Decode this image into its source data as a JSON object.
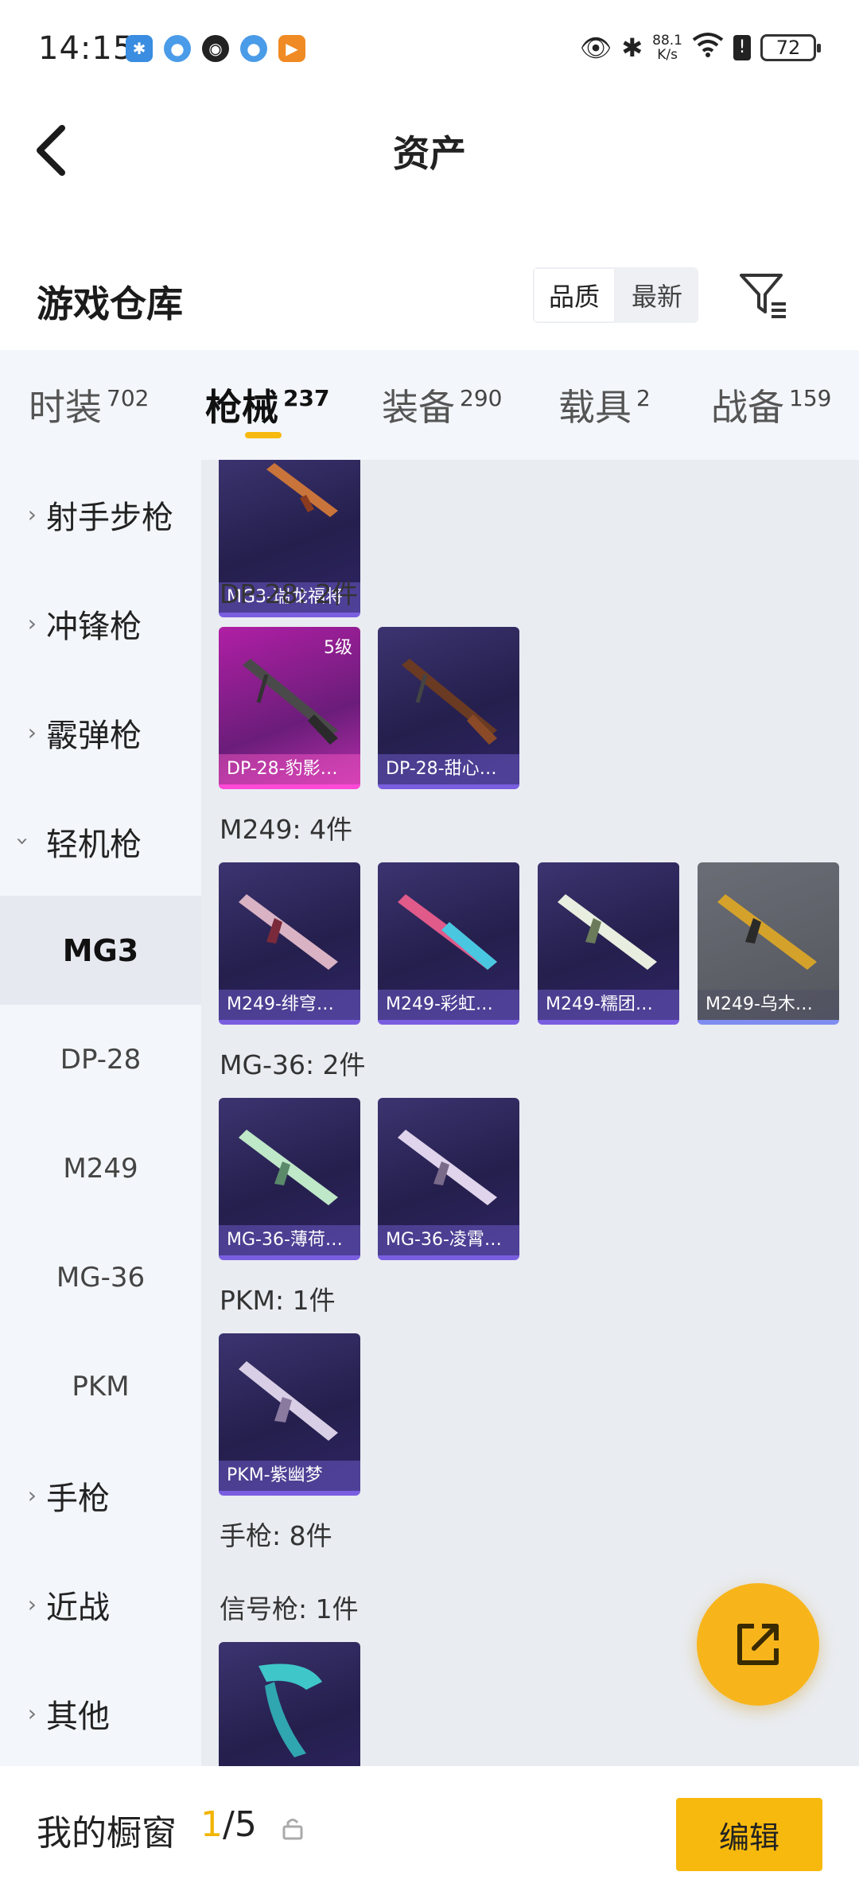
{
  "status_bar": {
    "time": "14:15",
    "speed_value": "88.1",
    "speed_unit": "K/s",
    "battery": "72"
  },
  "nav": {
    "title": "资产"
  },
  "section": {
    "title": "游戏仓库",
    "sort_options": [
      "品质",
      "最新"
    ],
    "active_sort": "品质"
  },
  "tabs": [
    {
      "label": "时装",
      "count": "702"
    },
    {
      "label": "枪械",
      "count": "237"
    },
    {
      "label": "装备",
      "count": "290"
    },
    {
      "label": "载具",
      "count": "2"
    },
    {
      "label": "战备",
      "count": "159"
    }
  ],
  "active_tab": "枪械",
  "sidebar": {
    "categories": [
      {
        "label": "射手步枪"
      },
      {
        "label": "冲锋枪"
      },
      {
        "label": "霰弹枪"
      },
      {
        "label": "轻机枪"
      }
    ],
    "subcategories": [
      {
        "label": "MG3"
      },
      {
        "label": "DP-28"
      },
      {
        "label": "M249"
      },
      {
        "label": "MG-36"
      },
      {
        "label": "PKM"
      }
    ],
    "active_sub": "MG3",
    "more_categories": [
      {
        "label": "手枪"
      },
      {
        "label": "近战"
      },
      {
        "label": "其他"
      }
    ]
  },
  "groups": {
    "mg3": {
      "items": [
        {
          "name": "MG3-瑞龙福将"
        }
      ]
    },
    "dp28": {
      "label": "DP-28: 2件",
      "items": [
        {
          "name": "DP-28-豹影…",
          "level": "5级"
        },
        {
          "name": "DP-28-甜心…"
        }
      ]
    },
    "m249": {
      "label": "M249: 4件",
      "items": [
        {
          "name": "M249-绯穹…"
        },
        {
          "name": "M249-彩虹…"
        },
        {
          "name": "M249-糯团…"
        },
        {
          "name": "M249-乌木…"
        }
      ]
    },
    "mg36": {
      "label": "MG-36: 2件",
      "items": [
        {
          "name": "MG-36-薄荷…"
        },
        {
          "name": "MG-36-凌霄…"
        }
      ]
    },
    "pkm": {
      "label": "PKM: 1件",
      "items": [
        {
          "name": "PKM-紫幽梦"
        }
      ]
    },
    "pistol": {
      "label": "手枪: 8件"
    },
    "flare": {
      "label": "信号枪: 1件"
    }
  },
  "bottom_bar": {
    "title": "我的橱窗",
    "count_current": "1",
    "count_total": "/5",
    "edit_label": "编辑"
  },
  "colors": {
    "accent": "#f7b90d",
    "card_purple": "#2b2558",
    "card_pink": "#b01fa5"
  }
}
